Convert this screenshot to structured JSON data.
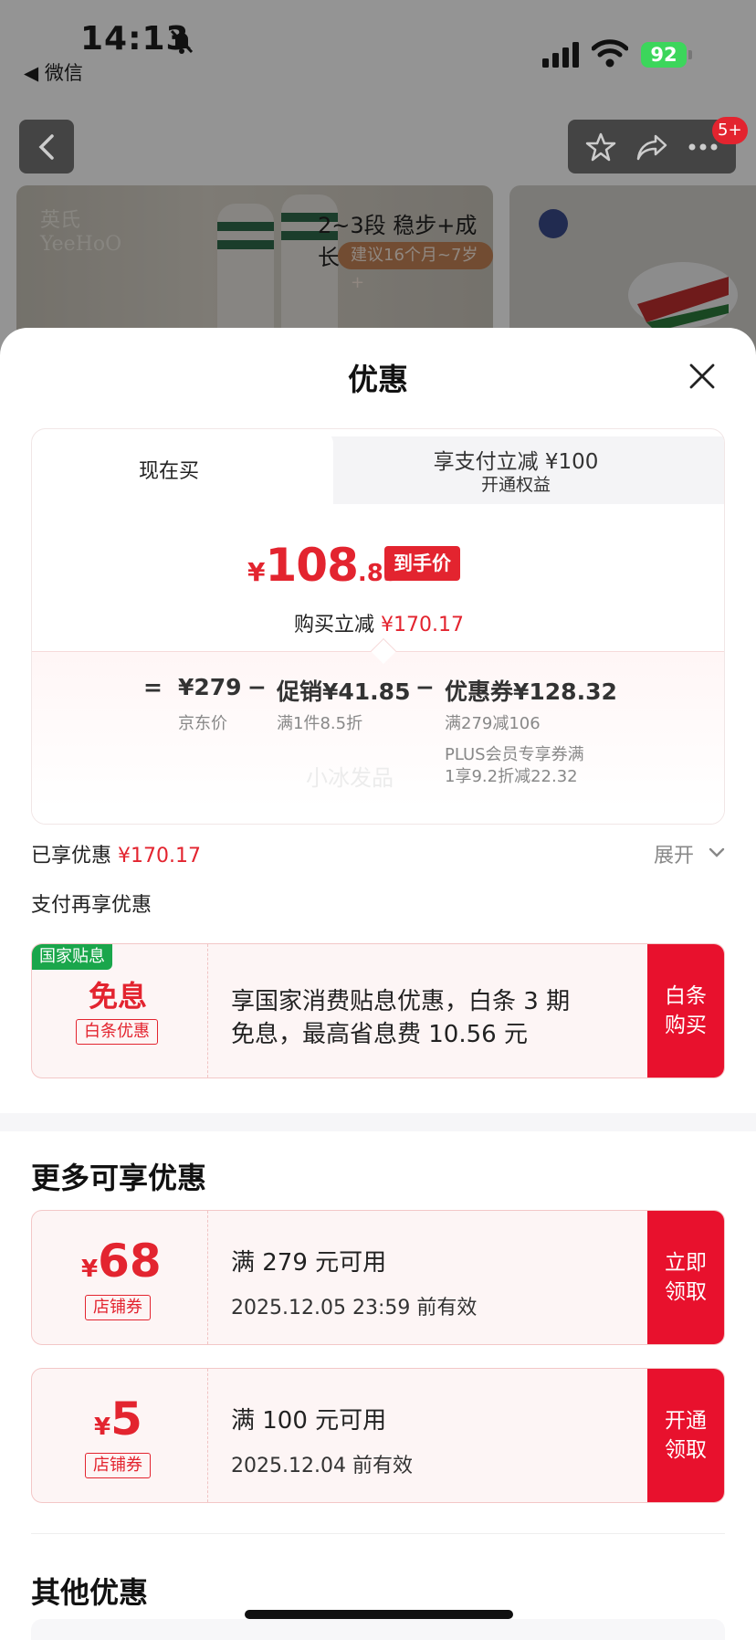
{
  "status_bar": {
    "time": "14:13",
    "back_app": "◀ 微信",
    "battery": "92"
  },
  "nav": {
    "badge": "5+"
  },
  "banner": {
    "logo_line1": "英氏",
    "logo_line2": "YeeHoO",
    "title": "2~3段 稳步+成长",
    "subtitle": "建议16个月~7岁+"
  },
  "sheet": {
    "title": "优惠"
  },
  "price_card": {
    "tab_now": "现在买",
    "tab_pay_line1": "享支付立减 ¥100",
    "tab_pay_line2": "开通权益",
    "final_price": {
      "yen": "¥",
      "int": "108",
      "dec": ".83",
      "tag": "到手价"
    },
    "reduce_label": "购买立减",
    "reduce_value": "¥170.17",
    "breakdown": {
      "eq": "=",
      "jd_price": "¥279",
      "jd_label": "京东价",
      "minus1": "−",
      "promo": "促销¥41.85",
      "promo_desc": "满1件8.5折",
      "minus2": "−",
      "coupon": "优惠券¥128.32",
      "coupon_desc1": "满279减106",
      "coupon_desc2": "PLUS会员专享券满",
      "coupon_desc3": "1享9.2折减22.32"
    },
    "watermark": "小冰发品"
  },
  "enjoyed": {
    "label": "已享优惠",
    "value": "¥170.17",
    "expand": "展开"
  },
  "pay_more": {
    "title": "支付再享优惠"
  },
  "coupon_interest": {
    "corner_tag": "国家贴息",
    "big": "免息",
    "tag": "白条优惠",
    "desc_line1": "享国家消费贴息优惠，白条 3 期",
    "desc_line2": "免息，最高省息费 10.56 元",
    "action": "白条购买"
  },
  "more": {
    "title": "更多可享优惠",
    "coupons": [
      {
        "yen": "¥",
        "amount": "68",
        "tag": "店铺券",
        "cond": "满 279 元可用",
        "valid": "2025.12.05 23:59 前有效",
        "action": "立即领取"
      },
      {
        "yen": "¥",
        "amount": "5",
        "tag": "店铺券",
        "cond": "满 100 元可用",
        "valid": "2025.12.04 前有效",
        "action": "开通领取"
      }
    ]
  },
  "other": {
    "title": "其他优惠"
  },
  "colors": {
    "accent_red": "#e3242f",
    "action_red": "#e8112d",
    "green_tag": "#1aa64b"
  }
}
